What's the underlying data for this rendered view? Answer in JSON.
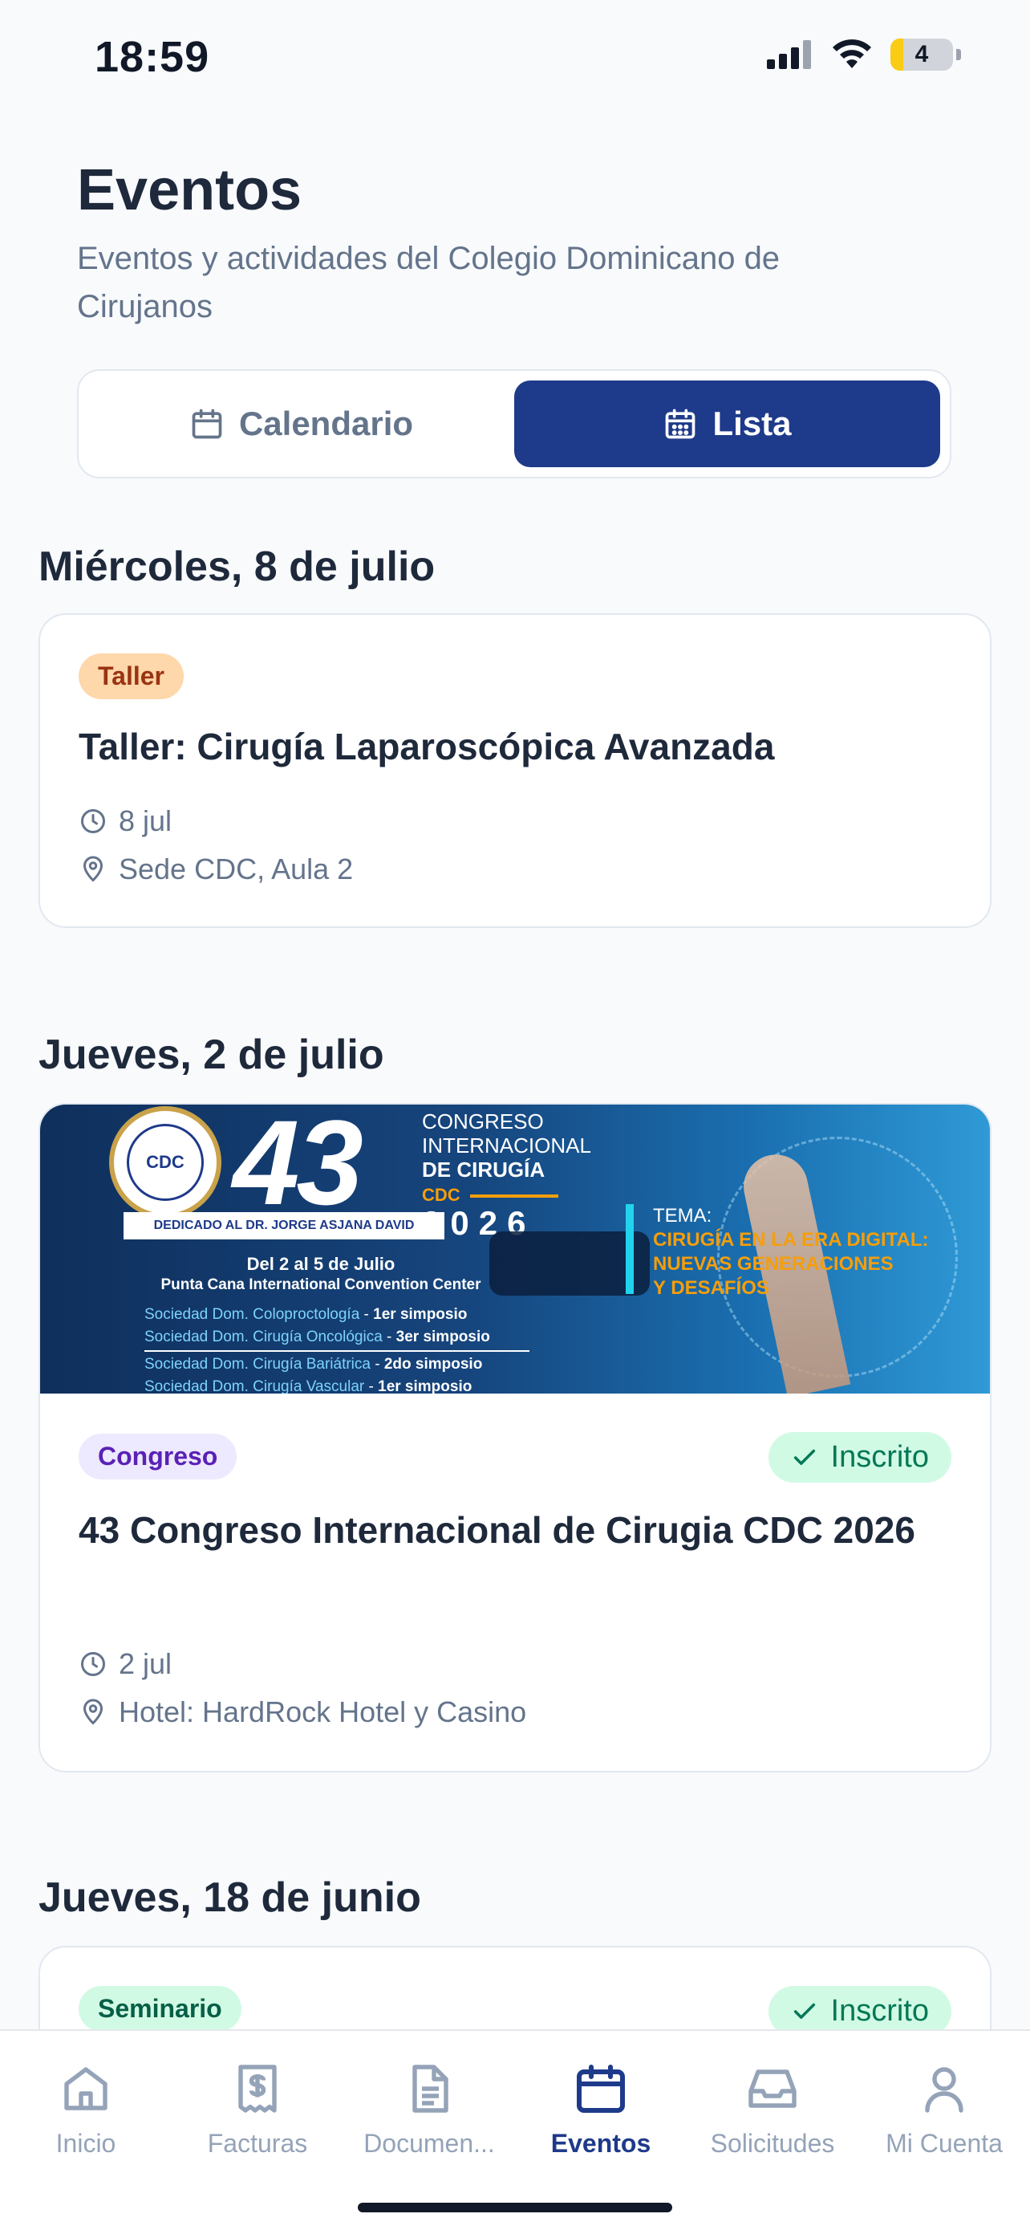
{
  "status_bar": {
    "time": "18:59",
    "battery": "4"
  },
  "header": {
    "title": "Eventos",
    "subtitle": "Eventos y actividades del Colegio Dominicano de Cirujanos"
  },
  "view_toggle": {
    "calendar_label": "Calendario",
    "list_label": "Lista",
    "selected": "Lista"
  },
  "sections": [
    {
      "date": "Miércoles, 8 de julio",
      "events": [
        {
          "category": "Taller",
          "title": "Taller: Cirugía Laparoscópica Avanzada",
          "date": "8 jul",
          "location": "Sede CDC, Aula 2"
        }
      ]
    },
    {
      "date": "Jueves, 2 de julio",
      "events": [
        {
          "category": "Congreso",
          "status": "Inscrito",
          "title": "43 Congreso Internacional de Cirugia CDC 2026",
          "date": "2 jul",
          "location": "Hotel: HardRock Hotel y Casino",
          "banner": {
            "number": "43",
            "seal_text": "CDC",
            "heading_1": "CONGRESO",
            "heading_2": "INTERNACIONAL",
            "heading_3": "DE CIRUGÍA",
            "cdc": "CDC",
            "year": "2026",
            "dedicated": "DEDICADO AL DR. JORGE ASJANA DAVID",
            "dates": "Del 2 al 5 de Julio",
            "venue": "Punta Cana International Convention Center",
            "societies": [
              {
                "name": "Sociedad Dom. Coloproctología",
                "symposium": "1er simposio"
              },
              {
                "name": "Sociedad Dom. Cirugía Oncológica",
                "symposium": "3er simposio"
              },
              {
                "name": "Sociedad Dom. Cirugía Bariátrica",
                "symposium": "2do simposio"
              },
              {
                "name": "Sociedad Dom. Cirugía Vascular",
                "symposium": "1er simposio"
              }
            ],
            "theme_label": "TEMA:",
            "theme_1": "CIRUGÍA EN LA ERA DIGITAL:",
            "theme_2": "NUEVAS GENERACIONES",
            "theme_3": "Y DESAFÍOS"
          }
        }
      ]
    },
    {
      "date": "Jueves, 18 de junio",
      "events": [
        {
          "category": "Seminario",
          "status": "Inscrito"
        }
      ]
    }
  ],
  "tabbar": {
    "items": [
      {
        "label": "Inicio",
        "icon": "home-icon"
      },
      {
        "label": "Facturas",
        "icon": "receipt-icon"
      },
      {
        "label": "Documen...",
        "icon": "document-icon"
      },
      {
        "label": "Eventos",
        "icon": "calendar-icon"
      },
      {
        "label": "Solicitudes",
        "icon": "inbox-icon"
      },
      {
        "label": "Mi Cuenta",
        "icon": "user-icon"
      }
    ],
    "active": "Eventos"
  },
  "colors": {
    "primary": "#1e3a8a",
    "taller_badge": "#fed7aa",
    "congreso_badge": "#ede9fe",
    "seminario_badge": "#d1fae5",
    "inscrito": "#047857"
  }
}
